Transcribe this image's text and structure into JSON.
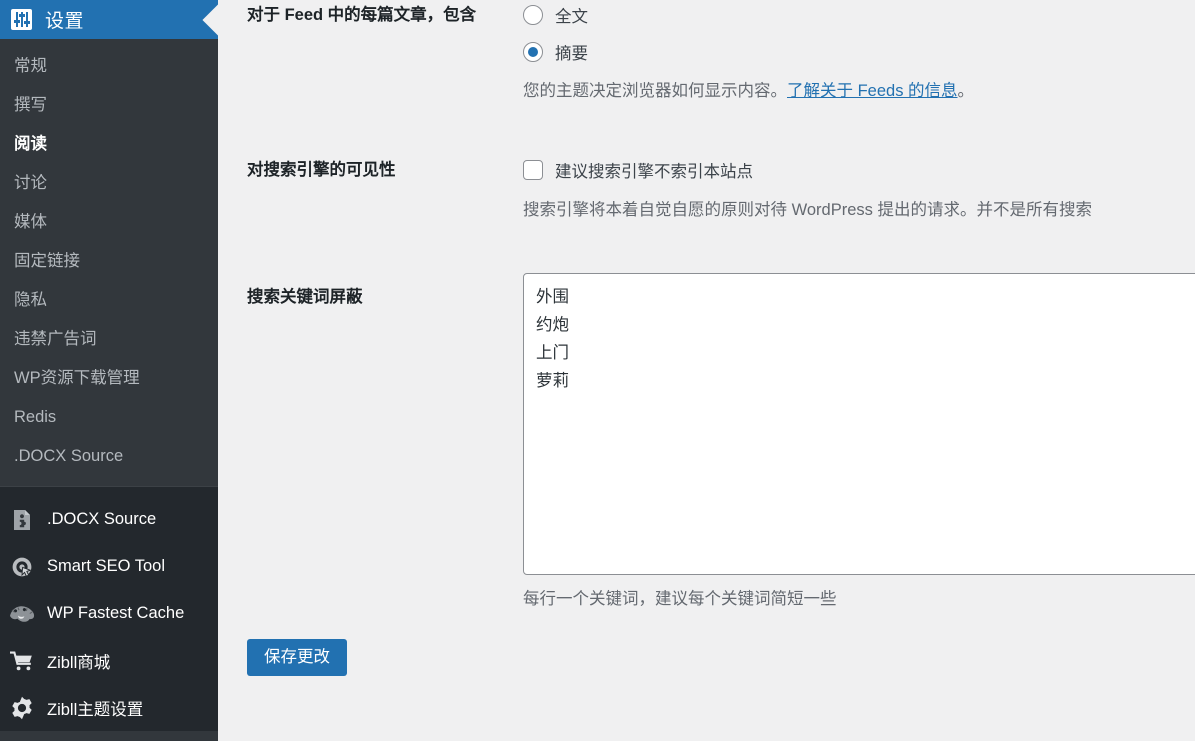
{
  "sidebar": {
    "header": {
      "title": "设置",
      "icon": "settings-sliders-icon"
    },
    "submenu": [
      {
        "label": "常规",
        "active": false
      },
      {
        "label": "撰写",
        "active": false
      },
      {
        "label": "阅读",
        "active": true
      },
      {
        "label": "讨论",
        "active": false
      },
      {
        "label": "媒体",
        "active": false
      },
      {
        "label": "固定链接",
        "active": false
      },
      {
        "label": "隐私",
        "active": false
      },
      {
        "label": "违禁广告词",
        "active": false
      },
      {
        "label": "WP资源下载管理",
        "active": false
      },
      {
        "label": "Redis",
        "active": false
      },
      {
        "label": ".DOCX Source",
        "active": false
      }
    ],
    "plugins": [
      {
        "label": ".DOCX Source",
        "icon": "document-plugin-icon"
      },
      {
        "label": "Smart SEO Tool",
        "icon": "seo-target-icon"
      },
      {
        "label": "WP Fastest Cache",
        "icon": "cheetah-icon"
      },
      {
        "label": "Zibll商城",
        "icon": "shopping-cart-icon"
      },
      {
        "label": "Zibll主题设置",
        "icon": "gear-icon"
      }
    ]
  },
  "main": {
    "feed_row": {
      "label": "对于 Feed 中的每篇文章，包含",
      "options": [
        {
          "value": "full",
          "label": "全文",
          "checked": false
        },
        {
          "value": "summary",
          "label": "摘要",
          "checked": true
        }
      ],
      "help_prefix": "您的主题决定浏览器如何显示内容。",
      "help_link": "了解关于 Feeds 的信息",
      "help_suffix": "。"
    },
    "visibility_row": {
      "label": "对搜索引擎的可见性",
      "checkbox_label": "建议搜索引擎不索引本站点",
      "checkbox_checked": false,
      "help": "搜索引擎将本着自觉自愿的原则对待 WordPress 提出的请求。并不是所有搜索"
    },
    "keywords_row": {
      "label": "搜索关键词屏蔽",
      "value": "外围\n约炮\n上门\n萝莉",
      "help": "每行一个关键词，建议每个关键词简短一些"
    },
    "save_label": "保存更改"
  },
  "colors": {
    "admin_blue": "#2271b1",
    "sidebar_bg": "#32373c",
    "sidebar_dark_bg": "#23282d",
    "page_bg": "#f0f0f1"
  }
}
